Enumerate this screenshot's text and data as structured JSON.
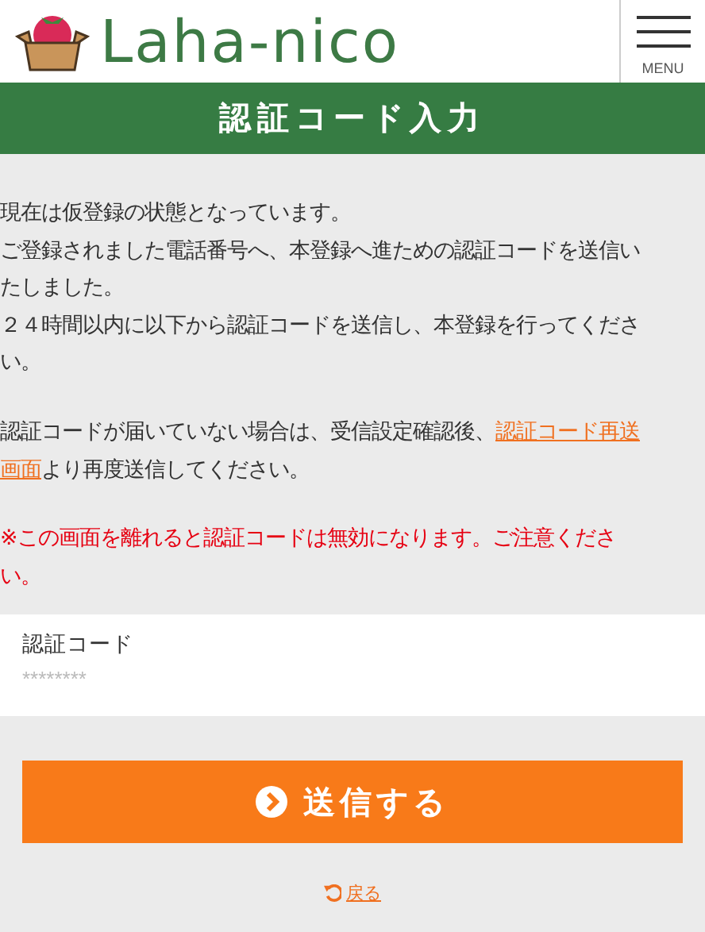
{
  "header": {
    "logo": "Laha-nico",
    "menu_label": "MENU"
  },
  "page_title": "認証コード入力",
  "paragraphs": [
    {
      "kind": "normal",
      "lines": [
        [
          {
            "kind": "text",
            "text": "現在は仮登録の状態となっています。"
          }
        ],
        [
          {
            "kind": "text",
            "text": "ご登録されました電話番号へ、本登録へ進ための認証コードを送信い"
          }
        ],
        [
          {
            "kind": "text",
            "text": "たしました。"
          }
        ],
        [
          {
            "kind": "text",
            "text": "２４時間以内に以下から認証コードを送信し、本登録を行ってくださ"
          }
        ],
        [
          {
            "kind": "text",
            "text": "い。"
          }
        ]
      ]
    },
    {
      "kind": "normal",
      "lines": [
        [
          {
            "kind": "text",
            "text": "認証コードが届いていない場合は、受信設定確認後、"
          },
          {
            "kind": "link",
            "text": "認証コード再送"
          }
        ],
        [
          {
            "kind": "link",
            "text": "画面"
          },
          {
            "kind": "text",
            "text": "より再度送信してください。"
          }
        ]
      ]
    },
    {
      "kind": "warning",
      "lines": [
        [
          {
            "kind": "text",
            "text": "※この画面を離れると認証コードは無効になります。ご注意くださ"
          }
        ],
        [
          {
            "kind": "text",
            "text": "い。"
          }
        ]
      ]
    }
  ],
  "form": {
    "label": "認証コード",
    "placeholder": "********"
  },
  "submit_button": "送信する",
  "back_link": "戻る"
}
